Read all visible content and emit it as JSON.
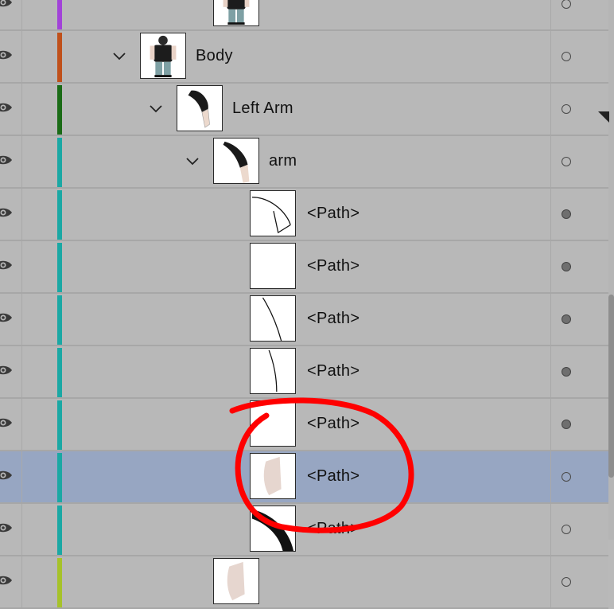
{
  "layers_panel": {
    "rows": [
      {
        "name": "",
        "indent": 0,
        "expanded": false,
        "color": "#a242d8",
        "thumb": "figure",
        "target": "empty",
        "selected": false
      },
      {
        "name": "Body",
        "indent": 1,
        "expanded": true,
        "color": "#c0501a",
        "thumb": "figure",
        "target": "empty",
        "selected": false
      },
      {
        "name": "Left Arm",
        "indent": 2,
        "expanded": true,
        "color": "#1a6b16",
        "thumb": "left-arm",
        "target": "empty",
        "selected": false
      },
      {
        "name": "arm",
        "indent": 3,
        "expanded": true,
        "color": "#1aa8a4",
        "thumb": "arm",
        "target": "empty",
        "selected": false
      },
      {
        "name": "<Path>",
        "indent": 4,
        "color": "#1aa8a4",
        "thumb": "curve-a",
        "target": "filled",
        "selected": false
      },
      {
        "name": "<Path>",
        "indent": 4,
        "color": "#1aa8a4",
        "thumb": "blank",
        "target": "filled",
        "selected": false
      },
      {
        "name": "<Path>",
        "indent": 4,
        "color": "#1aa8a4",
        "thumb": "line-a",
        "target": "filled",
        "selected": false
      },
      {
        "name": "<Path>",
        "indent": 4,
        "color": "#1aa8a4",
        "thumb": "line-b",
        "target": "filled",
        "selected": false
      },
      {
        "name": "<Path>",
        "indent": 4,
        "color": "#1aa8a4",
        "thumb": "blank",
        "target": "filled",
        "selected": false
      },
      {
        "name": "<Path>",
        "indent": 4,
        "color": "#1aa8a4",
        "thumb": "skin",
        "target": "empty",
        "selected": true
      },
      {
        "name": "<Path>",
        "indent": 4,
        "color": "#1aa8a4",
        "thumb": "sleeve",
        "target": "empty",
        "selected": false
      },
      {
        "name": "",
        "indent": 3,
        "color": "#a6c22a",
        "thumb": "skin",
        "target": "empty",
        "selected": false
      }
    ]
  },
  "colors": {
    "row_bg": "#b8b8b8",
    "selected_bg": "#97a6c2",
    "annotation": "#ff0000"
  },
  "icons": {
    "visibility": "eye-icon",
    "expand": "chevron-down-icon",
    "target": "target-circle-icon"
  }
}
